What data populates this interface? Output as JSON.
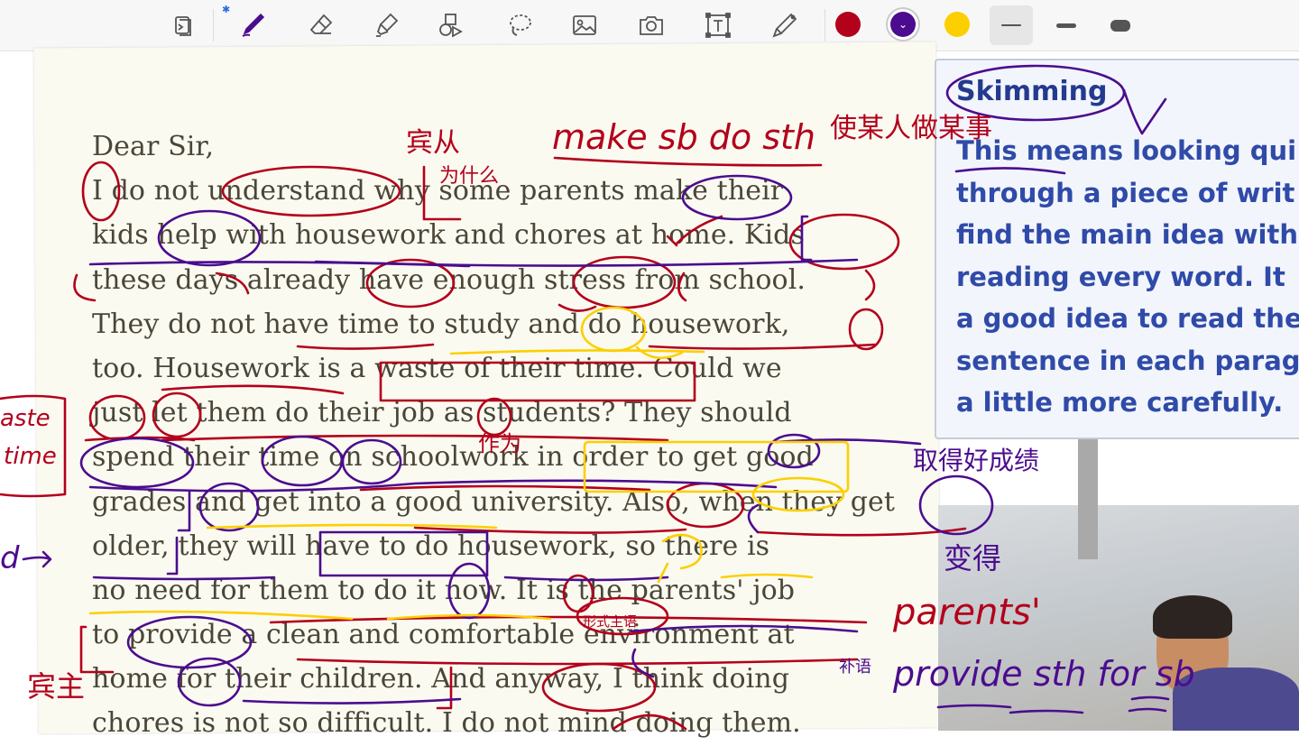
{
  "toolbar": {
    "tools": [
      {
        "name": "page-view-icon"
      },
      {
        "name": "pen-icon",
        "active": true
      },
      {
        "name": "eraser-icon"
      },
      {
        "name": "highlighter-icon"
      },
      {
        "name": "shapes-icon"
      },
      {
        "name": "lasso-icon"
      },
      {
        "name": "image-icon"
      },
      {
        "name": "camera-icon"
      },
      {
        "name": "text-box-icon"
      },
      {
        "name": "laser-pointer-icon"
      }
    ],
    "colors": [
      {
        "name": "red",
        "hex": "#b3001b",
        "selected": false
      },
      {
        "name": "purple",
        "hex": "#4b0c8f",
        "selected": true
      },
      {
        "name": "yellow",
        "hex": "#fccf00",
        "selected": false
      }
    ],
    "stroke_sizes": [
      "thin",
      "medium",
      "thick"
    ],
    "active_stroke": "thin"
  },
  "letter": {
    "lines": [
      "Dear Sir,",
      "I do not understand why some parents make their",
      "kids help with housework and chores at home. Kids",
      "these days already have enough stress from school.",
      "They do not have time to study and do housework,",
      "too. Housework is a waste of their time. Could we",
      "just let them do their job as students? They should",
      "spend their time on schoolwork in order to get good",
      "grades and get into a good university. Also, when they get",
      "older, they will have to do housework, so there is",
      "no need for them to do it now. It is the parents' job",
      "to provide a clean and comfortable environment at",
      "home for their children. And anyway, I think doing",
      "chores is not so difficult. I do not mind doing them."
    ]
  },
  "skimming": {
    "title": "Skimming",
    "lines": [
      "This means looking qui",
      "through a piece of writ",
      "find the main idea with",
      "reading every word. It",
      "a good idea to read the",
      "sentence in each parag",
      "a little more carefully."
    ]
  },
  "annotations": {
    "notes": [
      {
        "text": "宾从",
        "color": "#b3001b"
      },
      {
        "text": "为什么",
        "color": "#b3001b"
      },
      {
        "text": "make sb do sth",
        "color": "#b3001b"
      },
      {
        "text": "使某人做某事",
        "color": "#b3001b"
      },
      {
        "text": "aste",
        "color": "#b3001b"
      },
      {
        "text": "time",
        "color": "#b3001b"
      },
      {
        "text": "作为",
        "color": "#b3001b"
      },
      {
        "text": "取得好成绩",
        "color": "#4b0c8f"
      },
      {
        "text": "变得",
        "color": "#4b0c8f"
      },
      {
        "text": "形式主语",
        "color": "#b3001b"
      },
      {
        "text": "parents'",
        "color": "#b3001b"
      },
      {
        "text": "provide sth for sb",
        "color": "#4b0c8f"
      },
      {
        "text": "宾主",
        "color": "#b3001b"
      },
      {
        "text": "补语",
        "color": "#4b0c8f"
      },
      {
        "text": "d",
        "color": "#4b0c8f"
      }
    ]
  }
}
